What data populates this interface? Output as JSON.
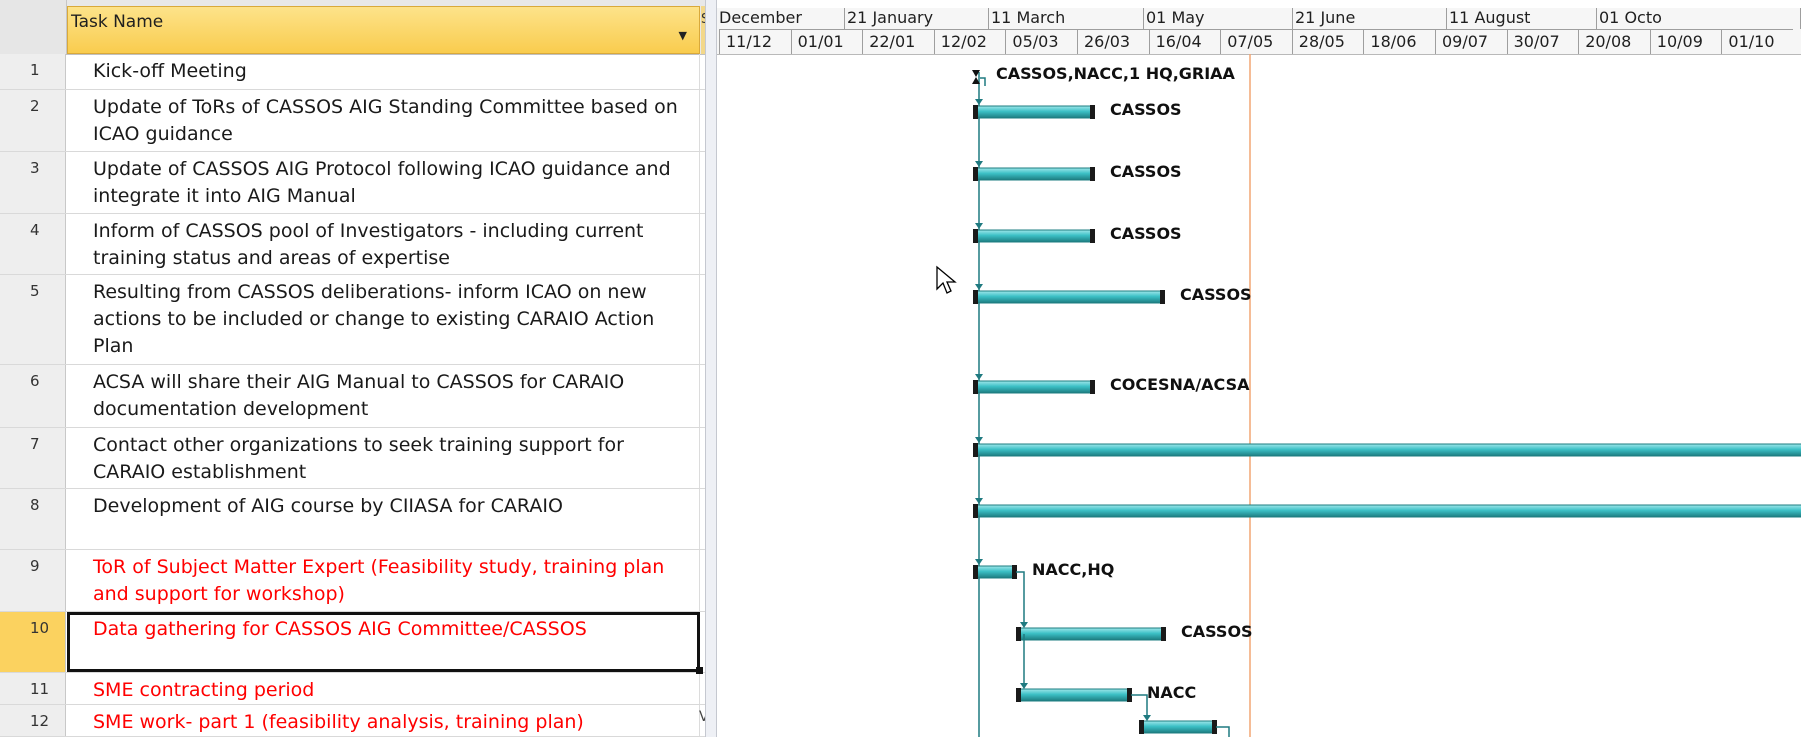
{
  "table": {
    "header": {
      "task_name": "Task Name",
      "next_col_initial": "S"
    },
    "rows": [
      {
        "id": "1",
        "name": "Kick-off Meeting",
        "next_col_initial": "",
        "color": "black"
      },
      {
        "id": "2",
        "name": "Update of ToRs of CASSOS AIG Standing Committee based on ICAO guidance",
        "next_col_initial": "",
        "color": "black"
      },
      {
        "id": "3",
        "name": "Update of CASSOS AIG Protocol following ICAO guidance and integrate it into AIG Manual",
        "next_col_initial": "",
        "color": "black"
      },
      {
        "id": "4",
        "name": "Inform of CASSOS pool of Investigators - including current training status and areas of expertise",
        "next_col_initial": "",
        "color": "black"
      },
      {
        "id": "5",
        "name": "Resulting from CASSOS deliberations- inform ICAO on new actions to be included or change to existing CARAIO Action Plan",
        "next_col_initial": "",
        "color": "black"
      },
      {
        "id": "6",
        "name": "ACSA will share their AIG Manual to CASSOS for CARAIO documentation development",
        "next_col_initial": "",
        "color": "black"
      },
      {
        "id": "7",
        "name": "Contact other organizations to seek training support for CARAIO establishment",
        "next_col_initial": "",
        "color": "black"
      },
      {
        "id": "8",
        "name": "Development of AIG course by CIIASA for CARAIO",
        "next_col_initial": "",
        "color": "black"
      },
      {
        "id": "9",
        "name": "ToR of Subject Matter Expert (Feasibility study, training plan and support for workshop)",
        "next_col_initial": "",
        "color": "red"
      },
      {
        "id": "10",
        "name": "Data gathering for CASSOS AIG Committee/CASSOS",
        "next_col_initial": "",
        "color": "red"
      },
      {
        "id": "11",
        "name": "SME contracting period",
        "next_col_initial": "",
        "color": "red"
      },
      {
        "id": "12",
        "name": "SME work- part 1 (feasibility analysis, training plan)",
        "next_col_initial": "V",
        "color": "red"
      }
    ]
  },
  "timescale": {
    "top_tier": [
      "December",
      "21 January",
      "11 March",
      "01 May",
      "21 June",
      "11 August",
      "01 Octo"
    ],
    "bottom_tier": [
      "11/12",
      "01/01",
      "22/01",
      "12/02",
      "05/03",
      "26/03",
      "16/04",
      "07/05",
      "28/05",
      "18/06",
      "09/07",
      "30/07",
      "20/08",
      "10/09",
      "01/10"
    ]
  },
  "gantt": {
    "bars": [
      {
        "row": "1",
        "kind": "milestone",
        "resource": "CASSOS,NACC,1 HQ,GRIAA"
      },
      {
        "row": "2",
        "kind": "bar",
        "resource": "CASSOS"
      },
      {
        "row": "3",
        "kind": "bar",
        "resource": "CASSOS"
      },
      {
        "row": "4",
        "kind": "bar",
        "resource": "CASSOS"
      },
      {
        "row": "5",
        "kind": "bar",
        "resource": "CASSOS"
      },
      {
        "row": "6",
        "kind": "bar",
        "resource": "COCESNA/ACSA"
      },
      {
        "row": "7",
        "kind": "bar",
        "resource": ""
      },
      {
        "row": "8",
        "kind": "bar",
        "resource": ""
      },
      {
        "row": "9",
        "kind": "bar",
        "resource": "NACC,HQ"
      },
      {
        "row": "10",
        "kind": "bar",
        "resource": "CASSOS"
      },
      {
        "row": "11",
        "kind": "bar",
        "resource": "NACC"
      },
      {
        "row": "12",
        "kind": "bar",
        "resource": ""
      }
    ],
    "colors": {
      "bar": "#3cc0c6",
      "bar_dark": "#1d7c80",
      "link": "#1f7a80",
      "status_line": "#f2a673",
      "name_red": "#ff0000"
    }
  }
}
